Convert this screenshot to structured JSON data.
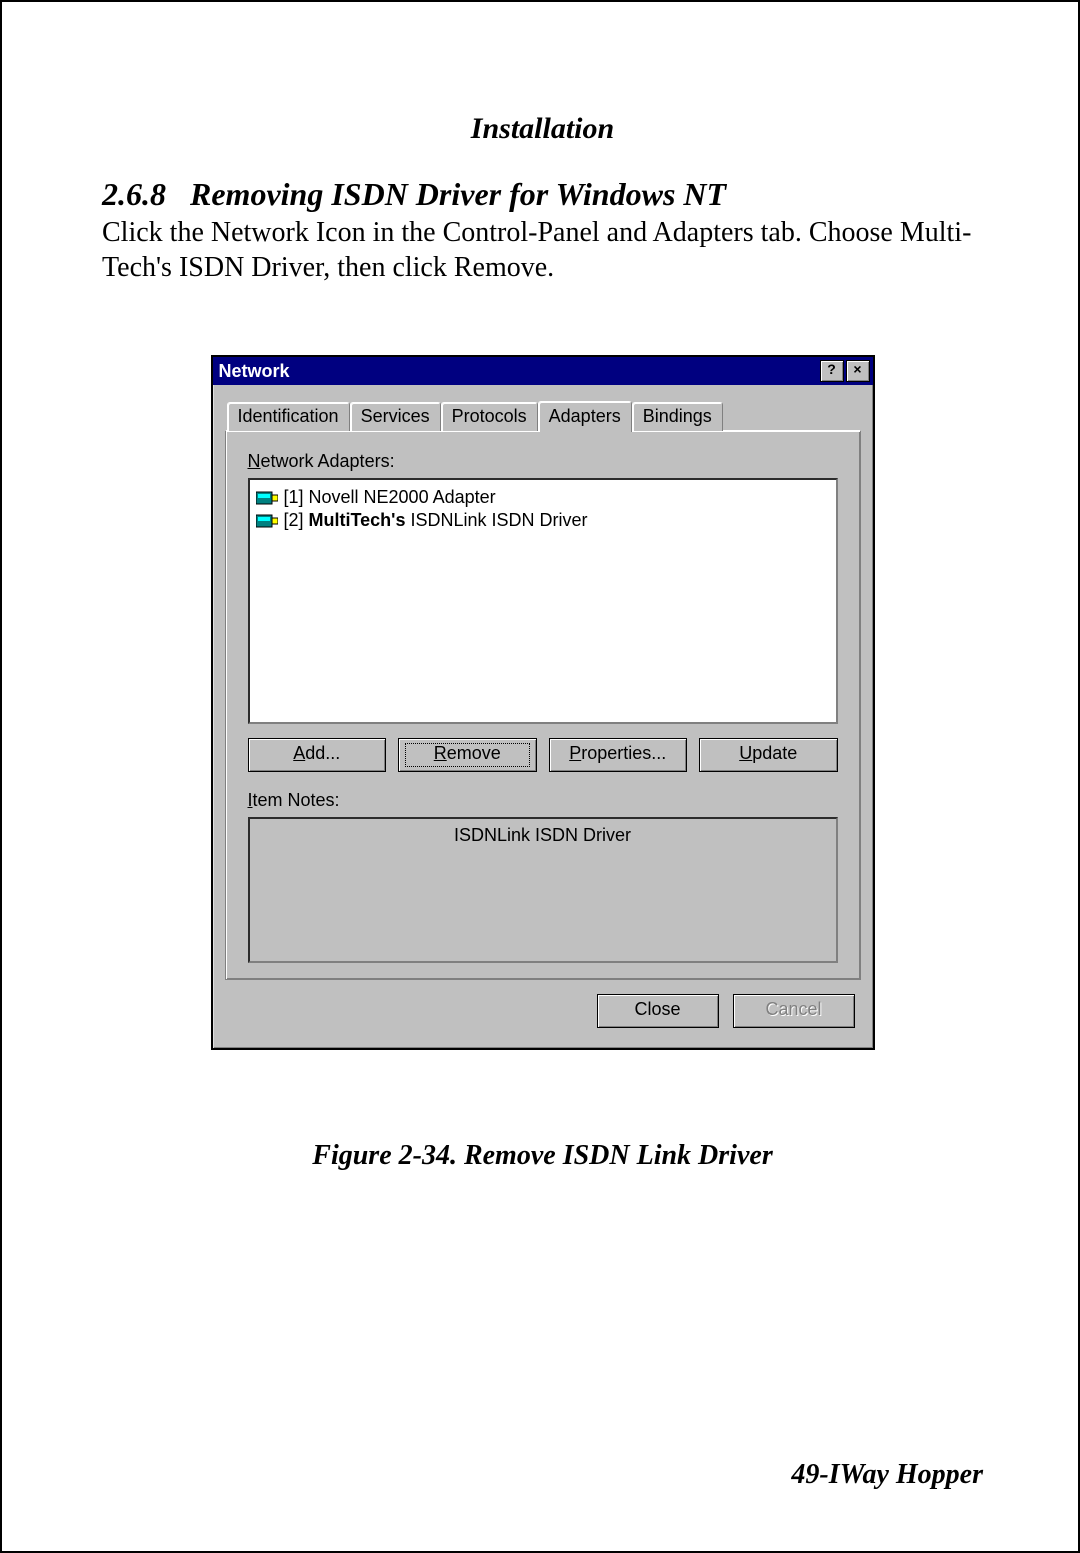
{
  "page": {
    "header": "Installation",
    "section_number": "2.6.8",
    "section_title": "Removing ISDN Driver for Windows NT",
    "paragraph": "Click the Network Icon in the Control-Panel and Adapters tab.  Choose Multi-Tech's ISDN Driver, then click Remove.",
    "figure_caption": "Figure 2-34. Remove ISDN Link Driver",
    "footer": "49-IWay Hopper"
  },
  "dialog": {
    "title": "Network",
    "help_symbol": "?",
    "close_symbol": "×",
    "tabs": [
      {
        "label": "Identification",
        "active": false
      },
      {
        "label": "Services",
        "active": false
      },
      {
        "label": "Protocols",
        "active": false
      },
      {
        "label": "Adapters",
        "active": true
      },
      {
        "label": "Bindings",
        "active": false
      }
    ],
    "adapters_label_pre": "N",
    "adapters_label_post": "etwork Adapters:",
    "list": [
      {
        "text": "[1] Novell NE2000 Adapter",
        "bold_prefix": ""
      },
      {
        "text_plain_prefix": "[2] ",
        "text_bold": "MultiTech's",
        "text_plain_suffix": " ISDNLink ISDN Driver"
      }
    ],
    "buttons": {
      "add_u": "A",
      "add_rest": "dd...",
      "remove_u": "R",
      "remove_rest": "emove",
      "props_u": "P",
      "props_rest": "roperties...",
      "update_u": "U",
      "update_rest": "pdate"
    },
    "item_notes_u": "I",
    "item_notes_rest": "tem Notes:",
    "item_notes_value": "ISDNLink ISDN Driver",
    "close_btn": "Close",
    "cancel_btn": "Cancel"
  }
}
